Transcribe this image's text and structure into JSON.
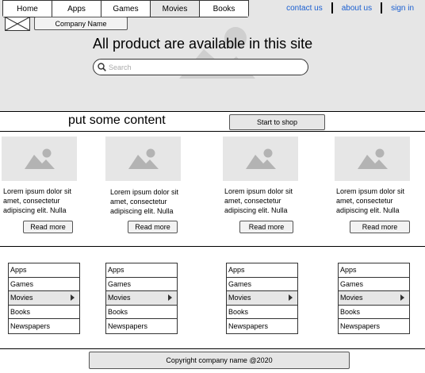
{
  "nav": {
    "tabs": [
      {
        "label": "Home"
      },
      {
        "label": "Apps"
      },
      {
        "label": "Games"
      },
      {
        "label": "Movies",
        "active": true
      },
      {
        "label": "Books"
      }
    ],
    "links": [
      "contact us",
      "about us",
      "sign in"
    ]
  },
  "header": {
    "company_label": "Company Name",
    "headline": "All product are available in this site",
    "search": {
      "placeholder": "Search",
      "value": ""
    }
  },
  "content": {
    "heading": "put some content",
    "shop_button": "Start to shop"
  },
  "cards": [
    {
      "text": "Lorem ipsum dolor sit amet, consectetur adipiscing elit. Nulla",
      "button": "Read more"
    },
    {
      "text": "Lorem ipsum dolor sit amet, consectetur adipiscing elit. Nulla",
      "button": "Read more"
    },
    {
      "text": "Lorem ipsum dolor sit amet, consectetur adipiscing elit. Nulla",
      "button": "Read more"
    },
    {
      "text": "Lorem ipsum dolor sit amet, consectetur adipiscing elit. Nulla",
      "button": "Read more"
    }
  ],
  "menus": [
    {
      "items": [
        "Apps",
        "Games",
        "Movies",
        "Books",
        "Newspapers"
      ],
      "active": "Movies"
    },
    {
      "items": [
        "Apps",
        "Games",
        "Movies",
        "Books",
        "Newspapers"
      ],
      "active": "Movies"
    },
    {
      "items": [
        "Apps",
        "Games",
        "Movies",
        "Books",
        "Newspapers"
      ],
      "active": "Movies"
    },
    {
      "items": [
        "Apps",
        "Games",
        "Movies",
        "Books",
        "Newspapers"
      ],
      "active": "Movies"
    }
  ],
  "footer": {
    "copyright": "Copyright company name @2020"
  },
  "colors": {
    "link": "#1a5fd1",
    "panel": "#e6e6e6",
    "border": "#333333"
  },
  "icons": [
    "image-placeholder-icon",
    "search-icon",
    "logo-placeholder-icon",
    "chevron-right-icon"
  ]
}
